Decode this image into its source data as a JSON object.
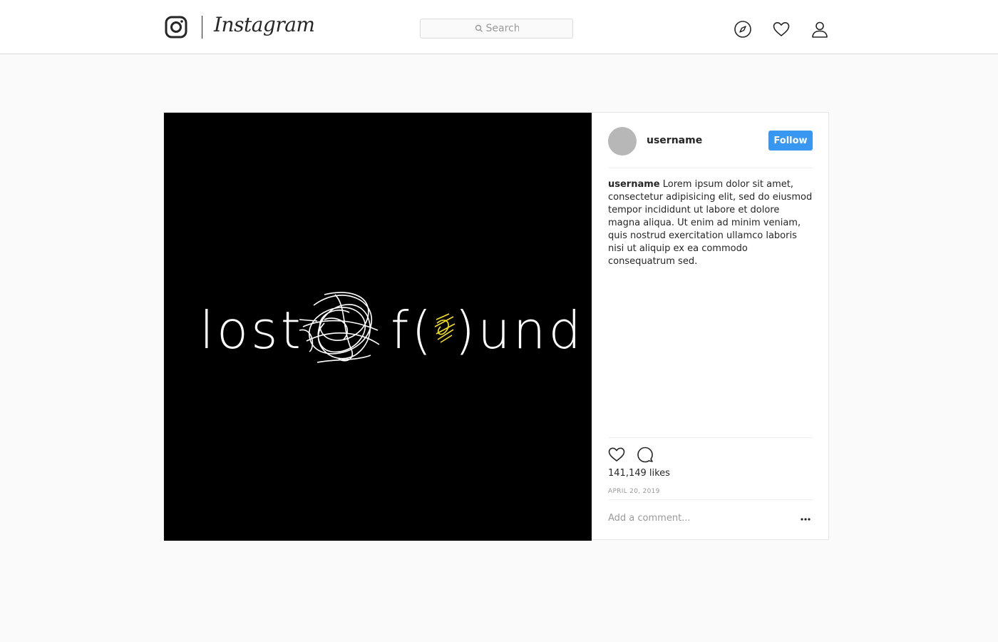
{
  "header": {
    "wordmark": "Instagram",
    "search_placeholder": "Search"
  },
  "post": {
    "artwork_text": {
      "word1": "lost",
      "word2_left": "f(",
      "word2_right": ")und"
    },
    "author": {
      "username": "username"
    },
    "follow_label": "Follow",
    "caption": {
      "username": "username",
      "text": "Lorem ipsum dolor sit amet, con­sectetur adipisicing elit, sed do eiusmod tempor incididunt ut labore et dolore magna aliqua. Ut enim ad minim veniam, quis nos­trud exercitation ullamco laboris nisi ut aliquip ex ea commodo consequatrum sed."
    },
    "likes": "141,149 likes",
    "date": "APRIL 20, 2019",
    "comment_placeholder": "Add a comment..."
  },
  "icons": {
    "logo": "instagram-camera-icon",
    "search": "search-icon",
    "explore": "compass-icon",
    "activity": "heart-icon",
    "profile": "user-icon",
    "like": "heart-icon",
    "comment": "comment-bubble-icon",
    "more": "ellipsis-icon"
  },
  "colors": {
    "accent": "#3897f0",
    "scribble_highlight": "#f5e11b"
  }
}
